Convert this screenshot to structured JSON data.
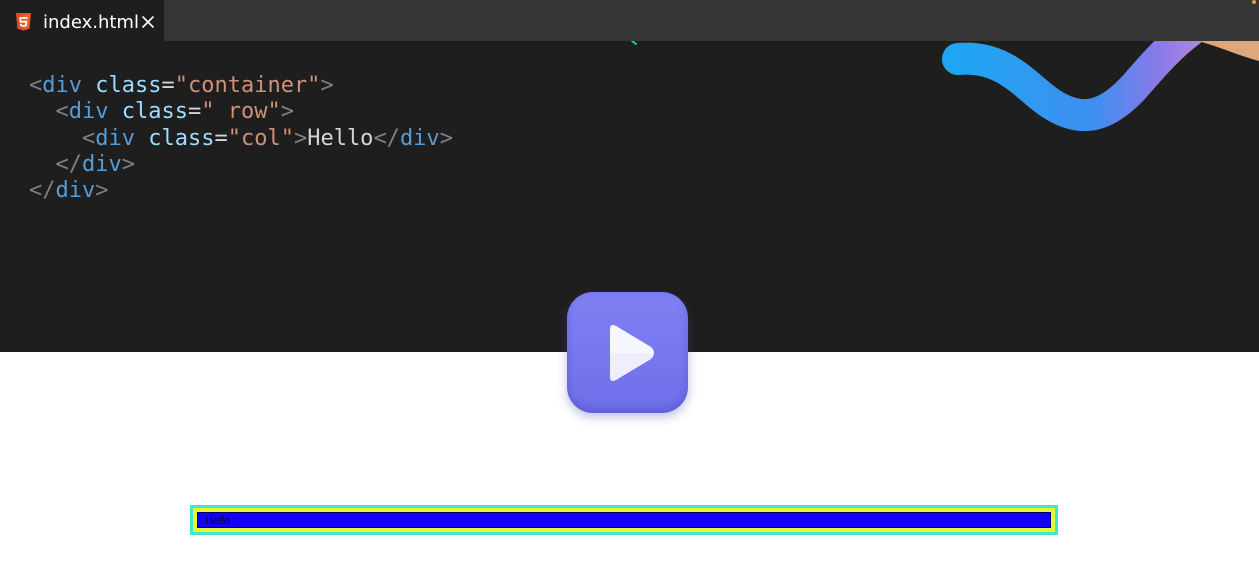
{
  "tab": {
    "icon": "html5-icon",
    "label": "index.html",
    "close_icon": "close-icon"
  },
  "code": {
    "lines": [
      [
        {
          "t": "<",
          "c": "punc"
        },
        {
          "t": "div",
          "c": "tag"
        },
        {
          "t": " ",
          "c": "txt"
        },
        {
          "t": "class",
          "c": "attr"
        },
        {
          "t": "=",
          "c": "txt"
        },
        {
          "t": "\"container\"",
          "c": "str"
        },
        {
          "t": ">",
          "c": "punc"
        }
      ],
      [
        {
          "t": "  ",
          "c": "txt"
        },
        {
          "t": "<",
          "c": "punc"
        },
        {
          "t": "div",
          "c": "tag"
        },
        {
          "t": " ",
          "c": "txt"
        },
        {
          "t": "class",
          "c": "attr"
        },
        {
          "t": "=",
          "c": "txt"
        },
        {
          "t": "\" row\"",
          "c": "str"
        },
        {
          "t": ">",
          "c": "punc"
        }
      ],
      [
        {
          "t": "    ",
          "c": "txt"
        },
        {
          "t": "<",
          "c": "punc"
        },
        {
          "t": "div",
          "c": "tag"
        },
        {
          "t": " ",
          "c": "txt"
        },
        {
          "t": "class",
          "c": "attr"
        },
        {
          "t": "=",
          "c": "txt"
        },
        {
          "t": "\"col\"",
          "c": "str"
        },
        {
          "t": ">",
          "c": "punc"
        },
        {
          "t": "Hello",
          "c": "txt"
        },
        {
          "t": "</",
          "c": "punc"
        },
        {
          "t": "div",
          "c": "tag"
        },
        {
          "t": ">",
          "c": "punc"
        }
      ],
      [
        {
          "t": "  ",
          "c": "txt"
        },
        {
          "t": "</",
          "c": "punc"
        },
        {
          "t": "div",
          "c": "tag"
        },
        {
          "t": ">",
          "c": "punc"
        }
      ],
      [
        {
          "t": "</",
          "c": "punc"
        },
        {
          "t": "div",
          "c": "tag"
        },
        {
          "t": ">",
          "c": "punc"
        }
      ]
    ]
  },
  "play_button": {
    "icon": "play-icon"
  },
  "preview": {
    "text": "Hello",
    "colors": {
      "container": "#3fe8c8",
      "row": "#e6f53a",
      "col": "#1400ff"
    }
  },
  "colors": {
    "editor_bg": "#1e1e1e",
    "tabbar_bg": "#353535",
    "play_button": "#7475ee"
  }
}
